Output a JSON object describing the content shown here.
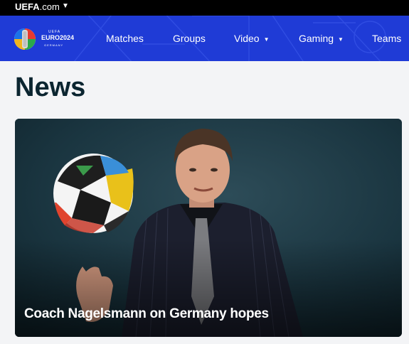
{
  "topbar": {
    "brand_main": "UEFA",
    "brand_domain": ".com",
    "caret": "▼"
  },
  "logo": {
    "uefa": "UEFA",
    "euro": "EURO2024",
    "country": "GERMANY"
  },
  "nav": {
    "items": [
      {
        "label": "Matches",
        "dropdown": false
      },
      {
        "label": "Groups",
        "dropdown": false
      },
      {
        "label": "Video",
        "dropdown": true
      },
      {
        "label": "Gaming",
        "dropdown": true
      },
      {
        "label": "Teams",
        "dropdown": false
      }
    ],
    "chevron": "▼"
  },
  "page": {
    "title": "News"
  },
  "news": {
    "featured_headline": "Coach Nagelsmann on Germany hopes"
  },
  "colors": {
    "topbar": "#000000",
    "nav": "#1f3bd6",
    "title": "#0b2530",
    "page_bg": "#f3f4f6"
  }
}
